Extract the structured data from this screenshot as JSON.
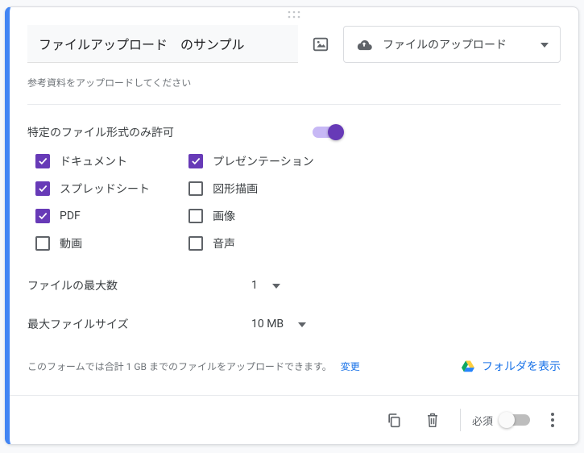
{
  "question": {
    "title": "ファイルアップロード　のサンプル",
    "description": "参考資料をアップロードしてください"
  },
  "typeSelect": {
    "label": "ファイルのアップロード"
  },
  "allowSpecific": {
    "label": "特定のファイル形式のみ許可",
    "on": true
  },
  "filetypes": {
    "col1": [
      {
        "label": "ドキュメント",
        "checked": true
      },
      {
        "label": "スプレッドシート",
        "checked": true
      },
      {
        "label": "PDF",
        "checked": true
      },
      {
        "label": "動画",
        "checked": false
      }
    ],
    "col2": [
      {
        "label": "プレゼンテーション",
        "checked": true
      },
      {
        "label": "図形描画",
        "checked": false
      },
      {
        "label": "画像",
        "checked": false
      },
      {
        "label": "音声",
        "checked": false
      }
    ]
  },
  "maxFiles": {
    "label": "ファイルの最大数",
    "value": "1"
  },
  "maxSize": {
    "label": "最大ファイルサイズ",
    "value": "10 MB"
  },
  "hint": {
    "text": "このフォームでは合計 1 GB までのファイルをアップロードできます。",
    "changeLabel": "変更"
  },
  "driveLink": {
    "label": "フォルダを表示"
  },
  "footer": {
    "requiredLabel": "必須",
    "requiredOn": false
  }
}
